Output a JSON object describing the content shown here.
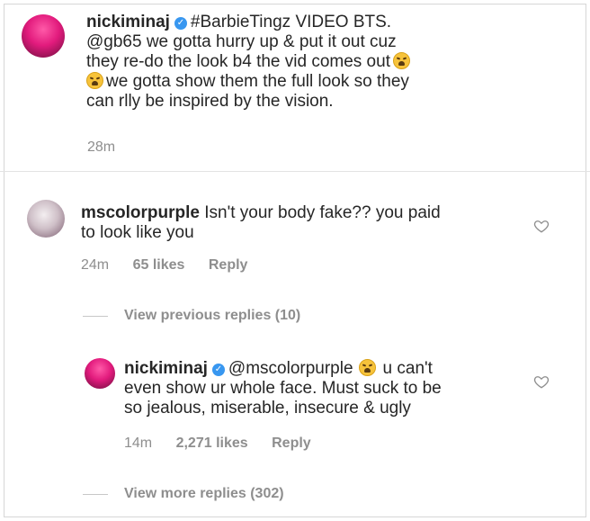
{
  "post": {
    "username": "nickiminaj",
    "line1_rest": "#BarbieTingz VIDEO BTS.",
    "line2": "@gb65 we gotta hurry up & put it out cuz",
    "line3": "they re-do the look b4 the vid comes out",
    "line4": "we gotta show them the full look so they",
    "line5": "can rlly be inspired by the vision.",
    "time": "28m"
  },
  "comment": {
    "username": "mscolorpurple",
    "line1_rest": "Isn't your body fake?? you paid",
    "line2": "to look like you",
    "time": "24m",
    "likes": "65 likes",
    "reply_label": "Reply"
  },
  "view_previous": "View previous replies (10)",
  "reply": {
    "username": "nickiminaj",
    "mention": "@mscolorpurple",
    "line1_end": "u can't",
    "line2": "even show ur whole face. Must suck to be",
    "line3": "so jealous, miserable, insecure & ugly",
    "time": "14m",
    "likes": "2,271 likes",
    "reply_label": "Reply"
  },
  "view_more": "View more replies (302)",
  "icons": {
    "verified": "verified-badge-icon",
    "like": "heart-icon",
    "emoji": "weary-face-emoji"
  },
  "colors": {
    "text": "#262626",
    "meta": "#8e8e8e",
    "verified": "#3897f0"
  }
}
